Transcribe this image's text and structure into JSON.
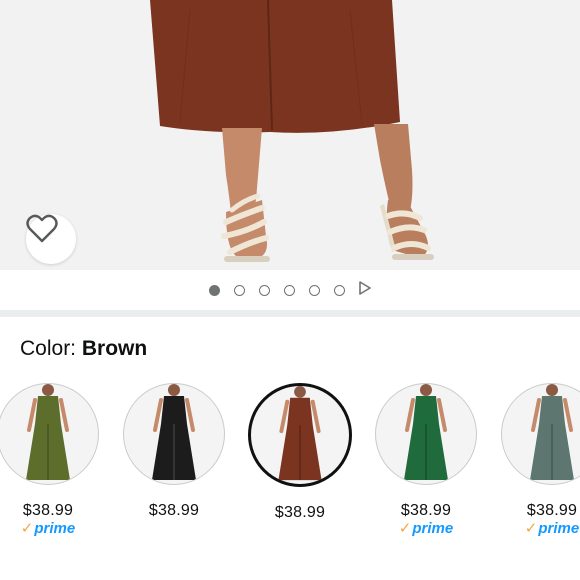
{
  "selector": {
    "label": "Color:",
    "selected_color": "Brown"
  },
  "carousel": {
    "image_count": 6,
    "active_index": 0
  },
  "swatches": [
    {
      "color": "Olive Green",
      "hex": "#5d6e2c",
      "price": "$38.99",
      "prime": "prime",
      "selected": false
    },
    {
      "color": "Black",
      "hex": "#1c1c1c",
      "price": "$38.99",
      "prime": "",
      "selected": false
    },
    {
      "color": "Brown",
      "hex": "#7a3420",
      "price": "$38.99",
      "prime": "",
      "selected": true
    },
    {
      "color": "Green",
      "hex": "#1f6b3b",
      "price": "$38.99",
      "prime": "prime",
      "selected": false
    },
    {
      "color": "Grey Green",
      "hex": "#5e7670",
      "price": "$38.99",
      "prime": "prime",
      "selected": false
    }
  ],
  "colors": {
    "prime_check": "#f3a847",
    "prime_text": "#1399ff",
    "dot": "#6f7373",
    "separator": "#eaeded"
  },
  "icons": {
    "wishlist": "heart-outline-icon",
    "prime_check": "check-icon",
    "carousel_next": "play-icon"
  }
}
